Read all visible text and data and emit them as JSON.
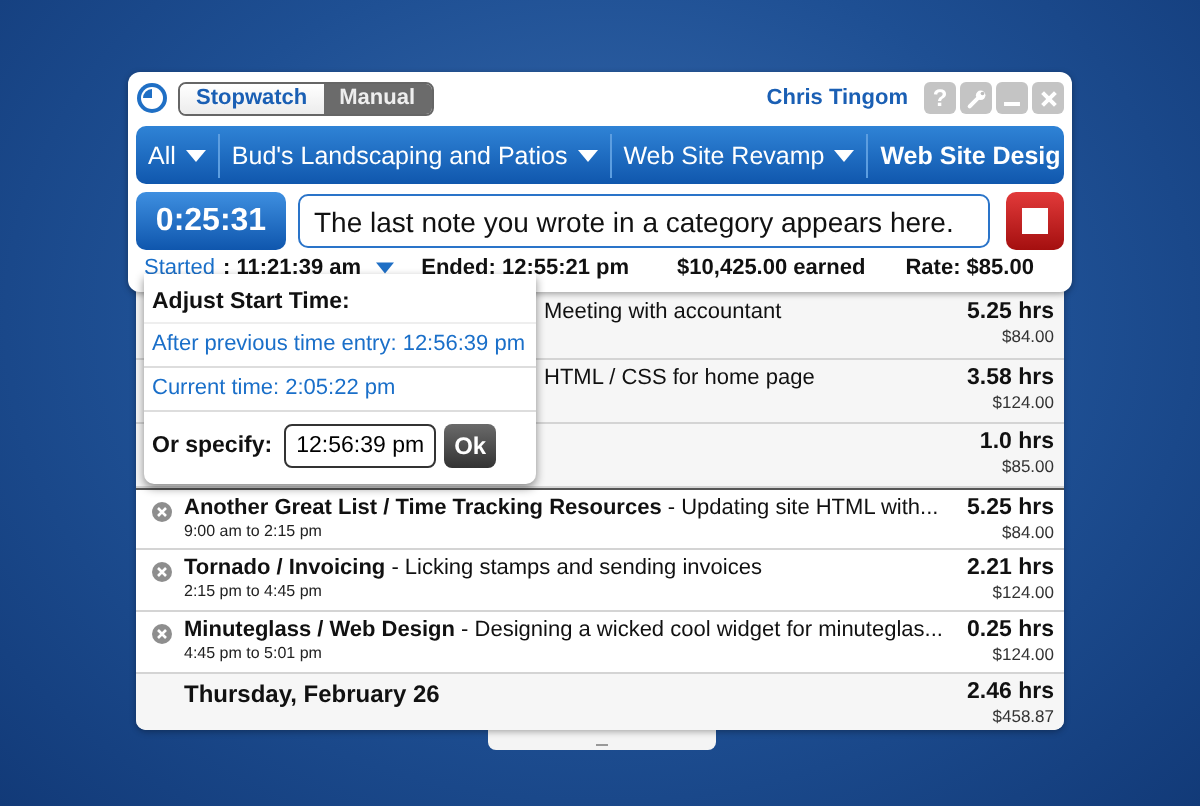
{
  "header": {
    "modes": [
      {
        "label": "Stopwatch",
        "selected": true
      },
      {
        "label": "Manual",
        "selected": false
      }
    ],
    "user": "Chris Tingom",
    "window_buttons": [
      {
        "kind": "help",
        "label": "?"
      },
      {
        "kind": "settings"
      },
      {
        "kind": "minimize"
      },
      {
        "kind": "close"
      }
    ]
  },
  "breadcrumbs": [
    {
      "label": "All",
      "dropdown": true,
      "selected": false
    },
    {
      "label": "Bud's Landscaping and Patios",
      "dropdown": true,
      "selected": false
    },
    {
      "label": "Web Site Revamp",
      "dropdown": true,
      "selected": false
    },
    {
      "label": "Web Site Desig",
      "dropdown": false,
      "selected": true
    }
  ],
  "timer": {
    "time": "0:25:31",
    "running": true
  },
  "note": {
    "value": "The last note you wrote in a category appears here."
  },
  "stats": {
    "started_label": "Started",
    "started_value": ": 11:21:39 am",
    "ended": "Ended: 12:55:21 pm",
    "earned": "$10,425.00 earned",
    "rate": "Rate: $85.00"
  },
  "start_popover": {
    "title": "Adjust Start Time:",
    "options": [
      "After previous time entry: 12:56:39 pm",
      "Current time: 2:05:22 pm"
    ],
    "specify_label": "Or specify:",
    "specify_value": "12:56:39 pm",
    "ok": "Ok"
  },
  "entries": [
    {
      "kind": "partial",
      "description": "Meeting with accountant",
      "hours": "5.25 hrs",
      "amount": "$84.00"
    },
    {
      "kind": "partial",
      "description": "HTML / CSS for home page",
      "hours": "3.58 hrs",
      "amount": "$124.00"
    },
    {
      "kind": "partial",
      "hours": "1.0 hrs",
      "amount": "$85.00"
    },
    {
      "kind": "entry",
      "project": "Another Great List / Time Tracking Resources",
      "description": "- Updating site HTML with...",
      "time_range": "9:00 am to 2:15 pm",
      "hours": "5.25 hrs",
      "amount": "$84.00"
    },
    {
      "kind": "entry",
      "project": "Tornado / Invoicing",
      "description": "- Licking stamps and sending invoices",
      "time_range": "2:15 pm to 4:45 pm",
      "hours": "2.21 hrs",
      "amount": "$124.00"
    },
    {
      "kind": "entry",
      "project": "Minuteglass / Web Design",
      "description": "- Designing a wicked cool widget for minuteglas...",
      "time_range": "4:45 pm to 5:01 pm",
      "hours": "0.25 hrs",
      "amount": "$124.00"
    },
    {
      "kind": "summary",
      "day": "Thursday, February 26",
      "hours": "2.46 hrs",
      "amount": "$458.87"
    }
  ]
}
